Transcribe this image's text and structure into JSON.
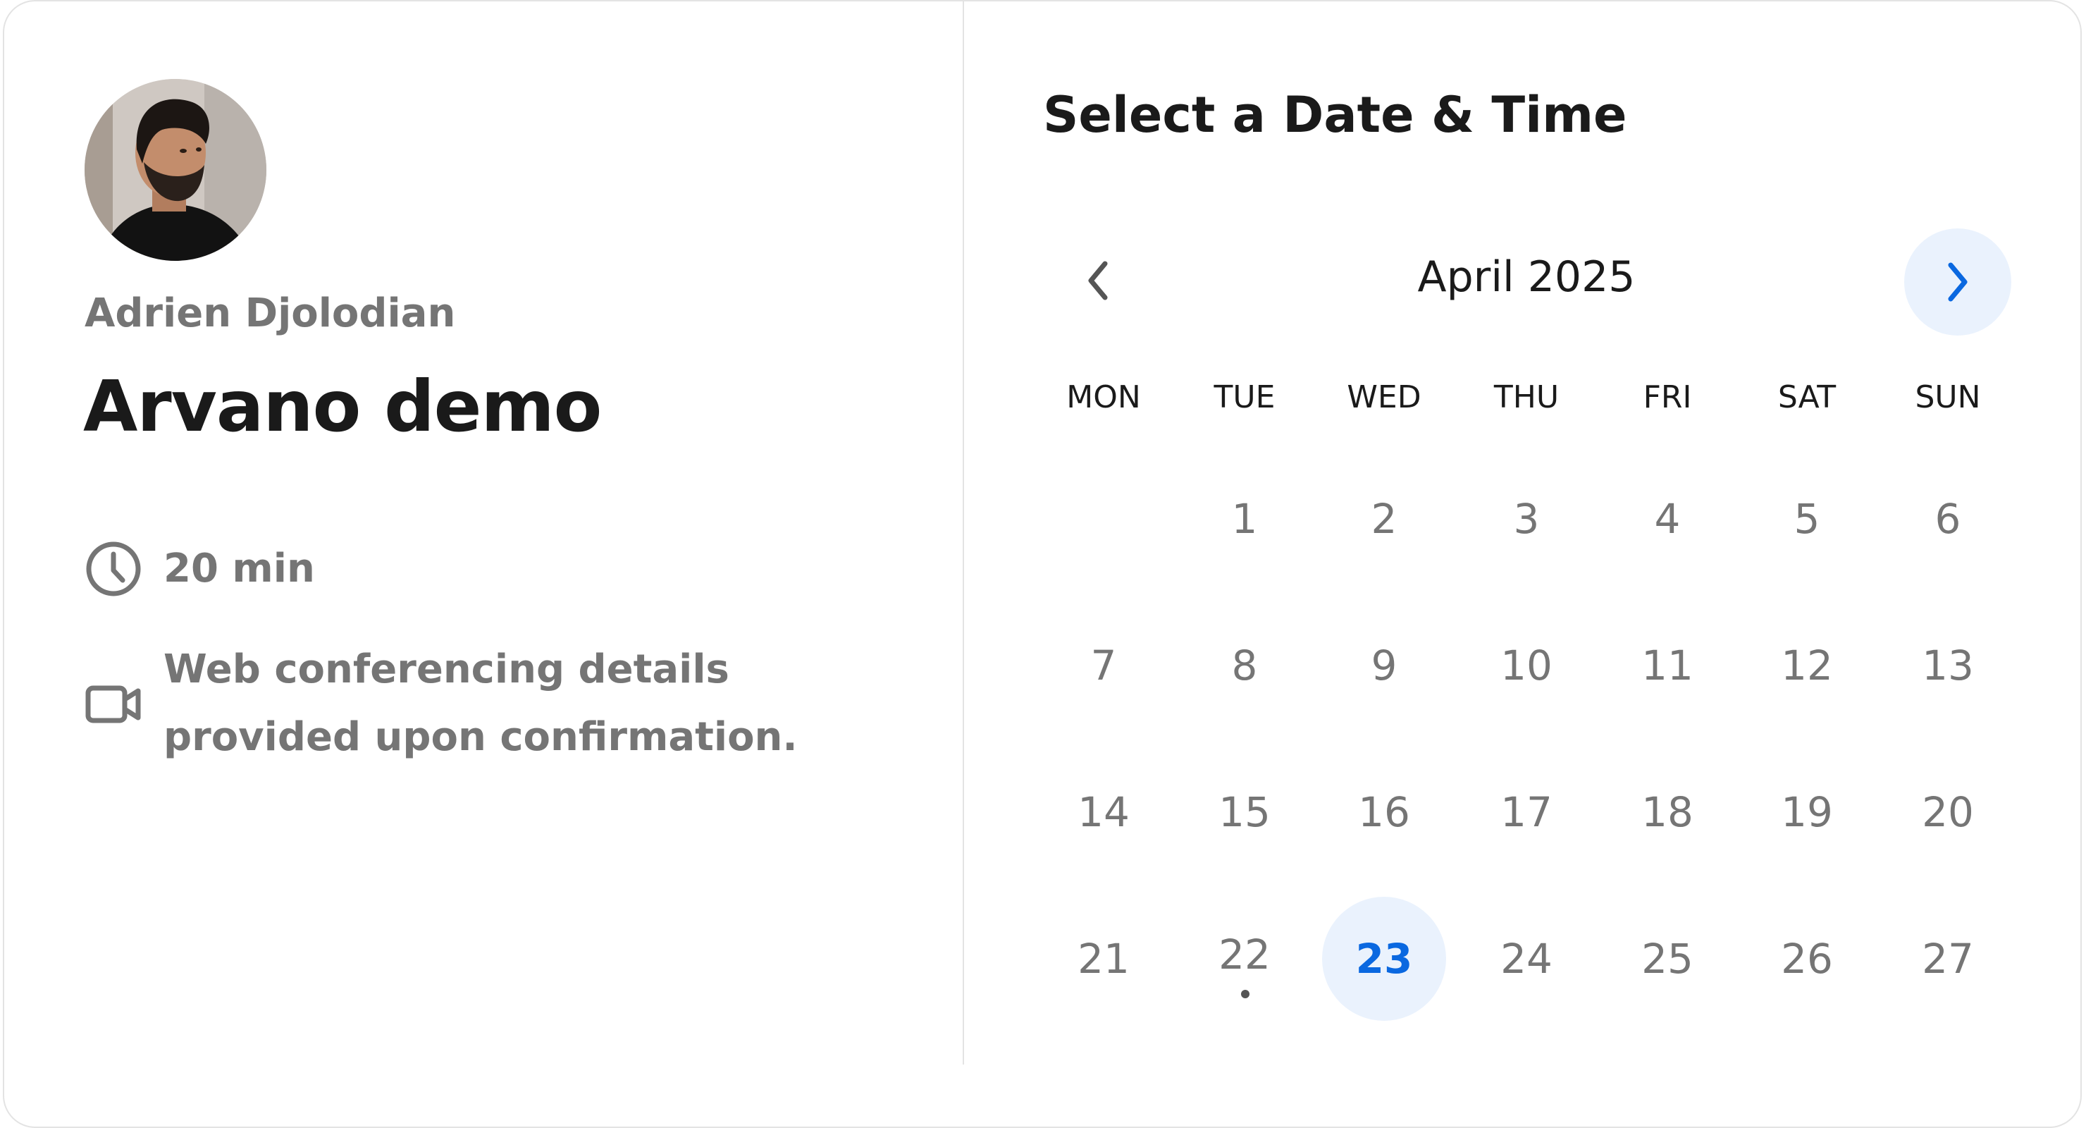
{
  "host": {
    "name": "Adrien Djolodian",
    "avatar_icon": "host-photo"
  },
  "event": {
    "title": "Arvano demo",
    "duration": "20 min",
    "duration_icon": "clock-icon",
    "conferencing": "Web conferencing details provided upon confirmation.",
    "conferencing_icon": "video-camera-icon"
  },
  "calendar": {
    "heading": "Select a Date & Time",
    "month_label": "April 2025",
    "prev_icon": "chevron-left-icon",
    "next_icon": "chevron-right-icon",
    "weekdays": [
      "MON",
      "TUE",
      "WED",
      "THU",
      "FRI",
      "SAT",
      "SUN"
    ],
    "weeks": [
      [
        "",
        "1",
        "2",
        "3",
        "4",
        "5",
        "6"
      ],
      [
        "7",
        "8",
        "9",
        "10",
        "11",
        "12",
        "13"
      ],
      [
        "14",
        "15",
        "16",
        "17",
        "18",
        "19",
        "20"
      ],
      [
        "21",
        "22",
        "23",
        "24",
        "25",
        "26",
        "27"
      ]
    ],
    "selected_day": "23",
    "today_marker_day": "22",
    "accent_color": "#0a68e0",
    "selected_bg_color": "#eaf2fd"
  }
}
